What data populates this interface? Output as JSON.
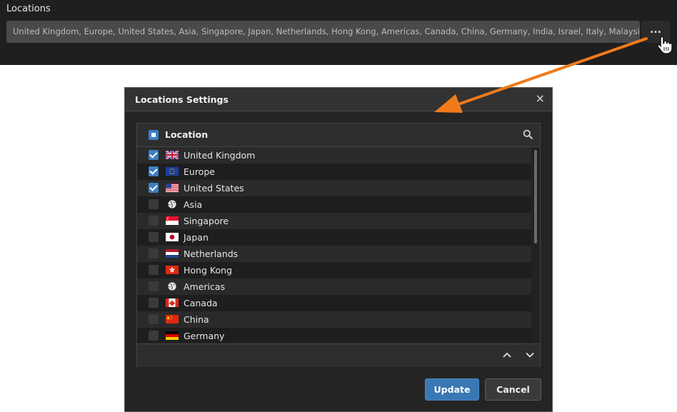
{
  "top": {
    "label": "Locations",
    "field_value": "United Kingdom, Europe, United States, Asia, Singapore, Japan, Netherlands, Hong Kong, Americas, Canada, China, Germany, India, Israel, Italy, Malaysia,",
    "ellipsis_label": "..."
  },
  "dialog": {
    "title": "Locations Settings",
    "close_label": "×",
    "list_header": "Location",
    "update_label": "Update",
    "cancel_label": "Cancel",
    "items": [
      {
        "label": "United Kingdom",
        "checked": true,
        "flag": "uk-flag-icon"
      },
      {
        "label": "Europe",
        "checked": true,
        "flag": "eu-flag-icon"
      },
      {
        "label": "United States",
        "checked": true,
        "flag": "us-flag-icon"
      },
      {
        "label": "Asia",
        "checked": false,
        "flag": "globe-icon"
      },
      {
        "label": "Singapore",
        "checked": false,
        "flag": "singapore-flag-icon"
      },
      {
        "label": "Japan",
        "checked": false,
        "flag": "japan-flag-icon"
      },
      {
        "label": "Netherlands",
        "checked": false,
        "flag": "netherlands-flag-icon"
      },
      {
        "label": "Hong Kong",
        "checked": false,
        "flag": "hongkong-flag-icon"
      },
      {
        "label": "Americas",
        "checked": false,
        "flag": "globe-icon"
      },
      {
        "label": "Canada",
        "checked": false,
        "flag": "canada-flag-icon"
      },
      {
        "label": "China",
        "checked": false,
        "flag": "china-flag-icon"
      },
      {
        "label": "Germany",
        "checked": false,
        "flag": "germany-flag-icon"
      }
    ]
  },
  "colors": {
    "accent": "#3d7fc1",
    "annotation_arrow": "#f07a1a"
  }
}
